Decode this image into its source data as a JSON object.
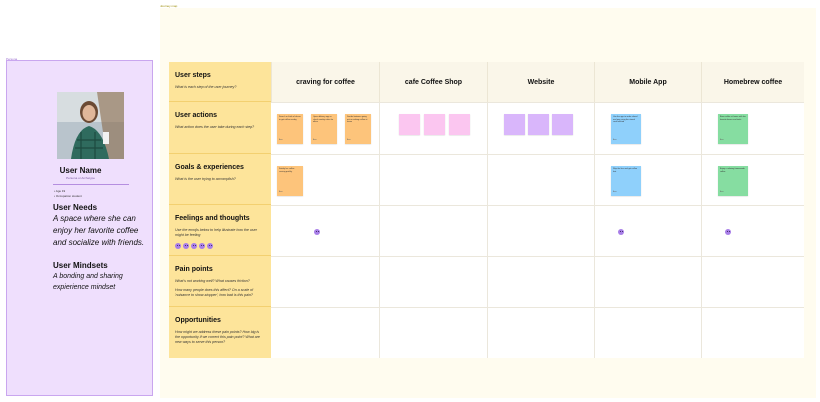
{
  "board": {
    "label": "Journey map"
  },
  "persona": {
    "label": "Persona",
    "name": "User Name",
    "title": "Persona or Archetype",
    "facts": [
      "Age 19",
      "Occupation student"
    ],
    "needs_heading": "User Needs",
    "needs_text": "A space where she can enjoy her favorite coffee and socialize with friends.",
    "mindsets_heading": "User Mindsets",
    "mindsets_text": "A bonding and sharing expierience mindset"
  },
  "columns": [
    "craving for coffee",
    "cafe Coffee Shop",
    "Website",
    "Mobile App",
    "Homebrew coffee"
  ],
  "rows": [
    {
      "title": "User steps",
      "subtitle": "What is each step of the user journey?"
    },
    {
      "title": "User actions",
      "subtitle": "What action does the user take during each step?"
    },
    {
      "title": "Goals & experiences",
      "subtitle": "What is the user trying to accomplish?"
    },
    {
      "title": "Feelings and thoughts",
      "subtitle": "Use the emojis below to help illustrate how the user might be feeling"
    },
    {
      "title": "Pain points",
      "subtitle": "What's not working well? What causes friction?",
      "subtitle2": "How many people does this affect? On a scale of 'nuisance to show-stopper', how bad is this pain?"
    },
    {
      "title": "Opportunities",
      "subtitle": "How might we address these pain points? How big is the opportunity if we correct this pain point? What are new ways to serve this person?"
    }
  ],
  "stickies": {
    "actions": [
      {
        "text": "Search or think of where to get coffee nearby",
        "author": "Ana"
      },
      {
        "text": "Open delivery app or check nearby cafes for offers",
        "author": "Ana"
      },
      {
        "text": "Decide between going out or making coffee at home",
        "author": "Ana"
      },
      {
        "text": "",
        "author": ""
      },
      {
        "text": "",
        "author": ""
      },
      {
        "text": "",
        "author": ""
      },
      {
        "text": "",
        "author": ""
      },
      {
        "text": "",
        "author": ""
      },
      {
        "text": "",
        "author": ""
      },
      {
        "text": "Use the app to order ahead and pay using the stored card method",
        "author": "Ana"
      },
      {
        "text": "Brew coffee at home with her favorite beans and tools",
        "author": "Ana"
      }
    ],
    "goals": [
      {
        "text": "Satisfy her coffee craving quickly",
        "author": "Ana"
      },
      {
        "text": "Skip the line and get coffee fast",
        "author": "Ana"
      },
      {
        "text": "Enjoy a relaxing homemade coffee",
        "author": "Ana"
      }
    ]
  },
  "colors": {
    "persona_bg": "#efdffd",
    "board_bg": "#fffcef",
    "row_header": "#fde49a",
    "orange": "#fdc47b",
    "pink": "#fbc6f0",
    "purple": "#d9b6fb",
    "blue": "#8fd0fb",
    "green": "#86dda1"
  }
}
